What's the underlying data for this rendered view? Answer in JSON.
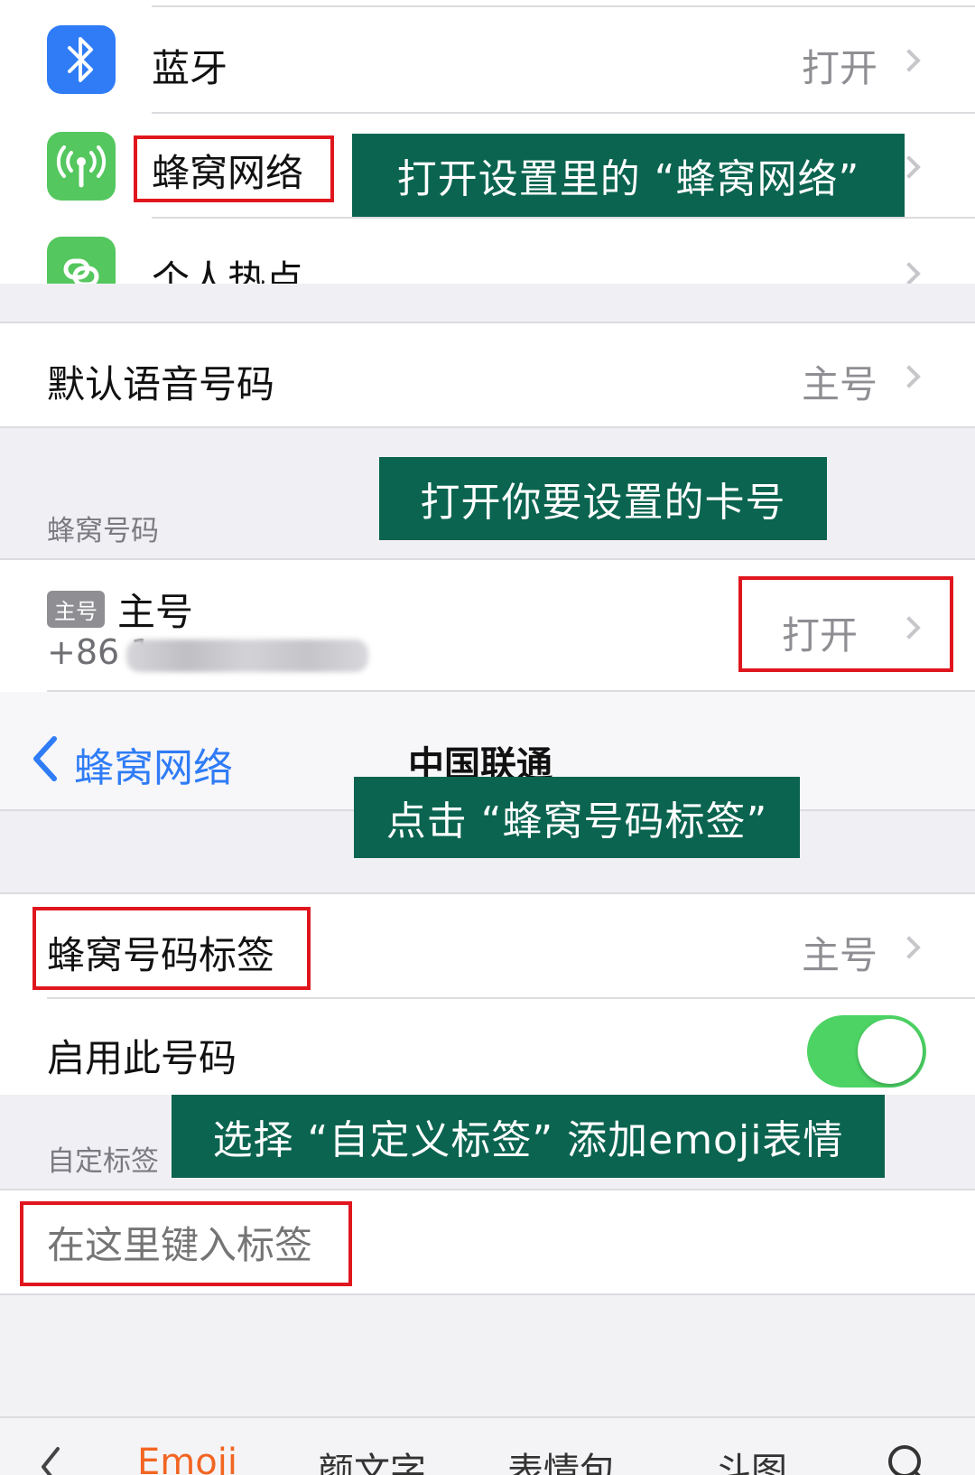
{
  "settings_top": {
    "bluetooth": {
      "label": "蓝牙",
      "value": "打开",
      "icon": "bluetooth-icon",
      "color": "#2f7cf6"
    },
    "cellular": {
      "label": "蜂窝网络",
      "icon": "antenna-icon",
      "color": "#54c75e"
    },
    "hotspot": {
      "label": "个人热点",
      "icon": "hotspot-link-icon",
      "color": "#54c75e"
    }
  },
  "cellular_page": {
    "default_voice": {
      "label": "默认语音号码",
      "value": "主号"
    },
    "section_label": "蜂窝号码",
    "primary_line": {
      "badge": "主号",
      "name": "主号",
      "number": "+86 1",
      "value": "打开"
    }
  },
  "line_page": {
    "nav_back_label": "蜂窝网络",
    "nav_title": "中国联通",
    "number_tag": {
      "label": "蜂窝号码标签",
      "value": "主号"
    },
    "enable_line": {
      "label": "启用此号码",
      "on": true
    },
    "custom_section_label": "自定标签",
    "custom_input_placeholder": "在这里键入标签"
  },
  "keyboard_bar": {
    "tabs": [
      "Emoji",
      "颜文字",
      "表情包",
      "斗图"
    ],
    "active_tab": "Emoji",
    "active_color": "#f26522"
  },
  "annotations": {
    "step1": "打开设置里的 “蜂窝网络”",
    "step2": "打开你要设置的卡号",
    "step3": "点击 “蜂窝号码标签”",
    "step4": "选择 “自定义标签” 添加emoji表情"
  },
  "colors": {
    "annotation_banner": "#0b6450",
    "highlight_box": "#e0161e",
    "link_blue": "#2f7cf6",
    "toggle_on": "#4cd364"
  }
}
